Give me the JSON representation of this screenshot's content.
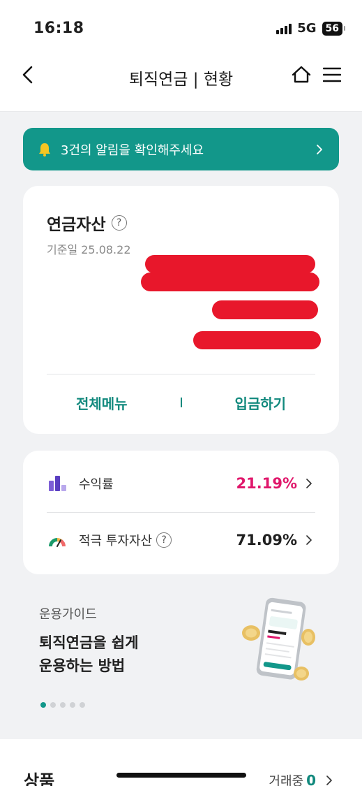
{
  "status": {
    "time": "16:18",
    "network": "5G",
    "battery": "56"
  },
  "nav": {
    "title": "퇴직연금 | 현황"
  },
  "alert": {
    "text": "3건의 알림을 확인해주세요"
  },
  "asset": {
    "title": "연금자산",
    "help": "?",
    "date": "기준일 25.08.22",
    "actions": {
      "menu": "전체메뉴",
      "deposit": "입금하기"
    }
  },
  "stats": {
    "return": {
      "label": "수익률",
      "value": "21.19%"
    },
    "active": {
      "label": "적극 투자자산",
      "value": "71.09%"
    }
  },
  "guide": {
    "kicker": "운용가이드",
    "title_line1": "퇴직연금을 쉽게",
    "title_line2": "운용하는 방법"
  },
  "products": {
    "title": "상품",
    "trading_label": "거래중",
    "trading_count": "0"
  },
  "colors": {
    "accent": "#12978a",
    "pink": "#e0176b"
  }
}
